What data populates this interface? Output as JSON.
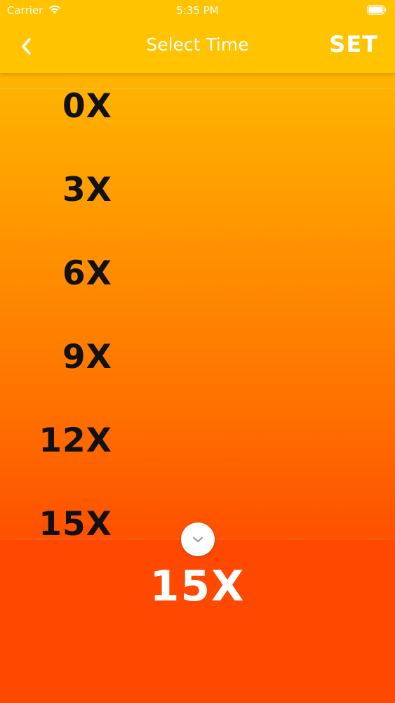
{
  "status_bar": {
    "carrier": "Carrier",
    "time": "5:35 PM"
  },
  "nav": {
    "title": "Select Time",
    "set_label": "SET",
    "back_icon": "chevron-left-icon"
  },
  "picker": {
    "items": [
      {
        "label": "0X"
      },
      {
        "label": "3X"
      },
      {
        "label": "6X"
      },
      {
        "label": "9X"
      },
      {
        "label": "12X"
      },
      {
        "label": "15X"
      }
    ]
  },
  "collapse_icon": "chevron-down-icon",
  "selected": {
    "value": "15X"
  },
  "colors": {
    "header": "#FFC300",
    "gradient_top": "#FFC300",
    "gradient_bottom": "#FF4800",
    "selected_bg": "#FF4800",
    "text_dark": "#111111",
    "text_light": "#FFFFFF"
  }
}
